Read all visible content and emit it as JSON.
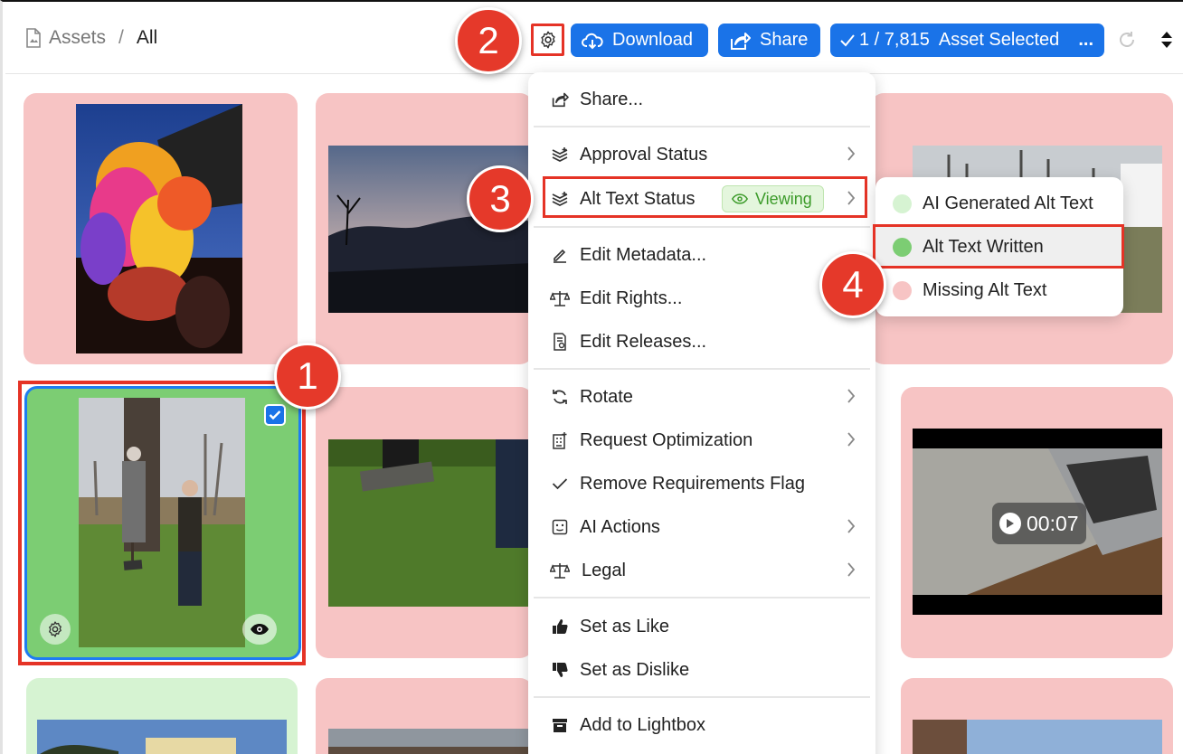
{
  "breadcrumb": {
    "root": "Assets",
    "separator": "/",
    "current": "All"
  },
  "toolbar": {
    "download_label": "Download",
    "share_label": "Share",
    "selected_label": "1 / 7,815  Asset Selected",
    "more_label": "..."
  },
  "menu": {
    "share": "Share...",
    "approval_status": "Approval Status",
    "alt_text_status": "Alt Text Status",
    "viewing_badge": "Viewing",
    "edit_metadata": "Edit Metadata...",
    "edit_rights": "Edit Rights...",
    "edit_releases": "Edit Releases...",
    "rotate": "Rotate",
    "request_optimization": "Request Optimization",
    "remove_requirements_flag": "Remove Requirements Flag",
    "ai_actions": "AI Actions",
    "legal": "Legal",
    "set_like": "Set as Like",
    "set_dislike": "Set as Dislike",
    "add_lightbox": "Add to Lightbox"
  },
  "submenu": {
    "items": [
      {
        "label": "AI Generated Alt Text",
        "color": "#d6f3d2"
      },
      {
        "label": "Alt Text Written",
        "color": "#7ccd73"
      },
      {
        "label": "Missing Alt Text",
        "color": "#f7c4c4"
      }
    ]
  },
  "video": {
    "duration": "00:07"
  },
  "steps": {
    "one": "1",
    "two": "2",
    "three": "3",
    "four": "4"
  },
  "colors": {
    "accent": "#1a73e8",
    "callout": "#e5392a",
    "missing": "#f7c4c4",
    "written": "#7ccd73",
    "ai_generated": "#d6f3d2"
  }
}
